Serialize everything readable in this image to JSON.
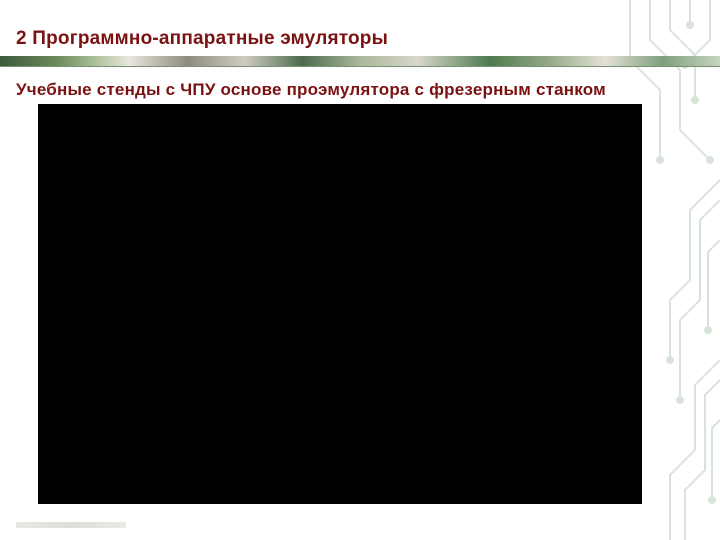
{
  "title": "2 Программно-аппаратные эмуляторы",
  "subtitle": "Учебные стенды с ЧПУ основе проэмулятора с фрезерным станком",
  "colors": {
    "heading": "#7a1212",
    "accent_green": "#2e5a2e",
    "black_area": "#000000"
  }
}
